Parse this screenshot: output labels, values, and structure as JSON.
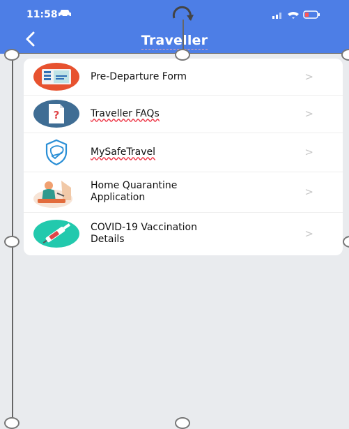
{
  "status_bar": {
    "time": "11:58"
  },
  "header": {
    "back_icon": "chevron-left-icon",
    "title": "Traveller"
  },
  "items": [
    {
      "label": "Pre-Departure Form",
      "icon": "form-icon",
      "chevron": ">"
    },
    {
      "label": "Traveller FAQs",
      "icon": "faq-icon",
      "chevron": ">"
    },
    {
      "label": "MySafeTravel",
      "icon": "shield-icon",
      "chevron": ">"
    },
    {
      "label_line1": "Home Quarantine",
      "label_line2": "Application",
      "icon": "home-quarantine-icon",
      "chevron": ">"
    },
    {
      "label_line1": "COVID-19 Vaccination",
      "label_line2": "Details",
      "icon": "vaccine-icon",
      "chevron": ">"
    }
  ],
  "colors": {
    "header": "#4d7ee6",
    "background": "#e9ebee"
  }
}
